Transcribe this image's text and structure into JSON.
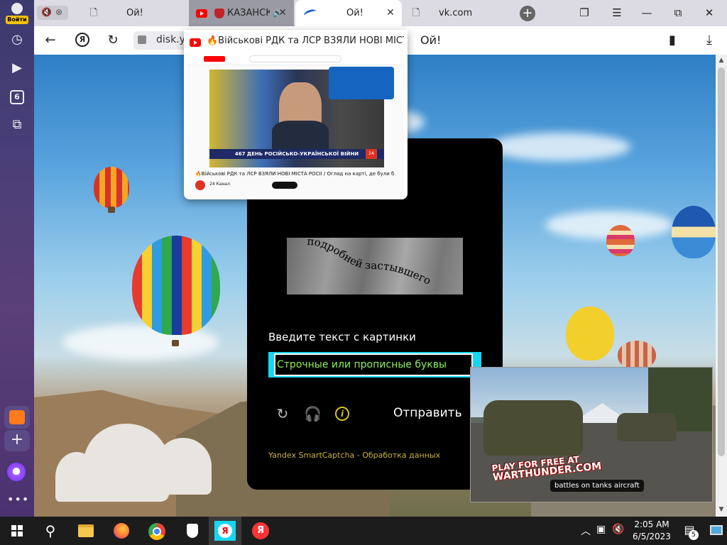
{
  "sidebar": {
    "login_label": "Войти",
    "tab_counter": "6",
    "icons": [
      "history-icon",
      "media-icon",
      "tabs-counter-icon",
      "screenshot-icon",
      "mail-icon",
      "add-icon",
      "alice-icon",
      "more-icon"
    ]
  },
  "tabs": [
    {
      "title": "Ой!",
      "icon": "page-icon"
    },
    {
      "title": "КАЗАНСКИЙ",
      "icon": "youtube-icon"
    },
    {
      "title": "Ой!",
      "icon": "yandex-disk-icon"
    },
    {
      "title": "vk.com",
      "icon": "page-icon"
    }
  ],
  "addressbar": {
    "url": "disk.y",
    "page_title": "Ой!"
  },
  "tab_preview": {
    "title": "🔥Військові РДК та ЛСР ВЗЯЛИ НОВІ МІСТА Р...",
    "video_caption": "467 ДЕНЬ РОСІЙСЬКО-УКРАЇНСЬКОЇ ВІЙНИ",
    "video_title": "🔥Військові РДК та ЛСР ВЗЯЛИ НОВІ МІСТА РОСІЇ / Огляд на карті, де були бої",
    "channel": "24 Канал",
    "channel_badge": "24"
  },
  "captcha": {
    "image_text": "подробней застывшего",
    "prompt": "Введите текст с картинки",
    "input_placeholder": "Строчные или прописные буквы",
    "info_symbol": "i",
    "submit_label": "Отправить",
    "footer": "Yandex SmartCaptcha - Обработка данных"
  },
  "ad": {
    "brand_line1": "PLAY FOR FREE AT",
    "brand_line2": "WARTHUNDER.COM",
    "tag": "battles on tanks aircraft"
  },
  "taskbar": {
    "time": "2:05 AM",
    "date": "6/5/2023",
    "notification_count": "5",
    "yandex_letter": "Я"
  }
}
